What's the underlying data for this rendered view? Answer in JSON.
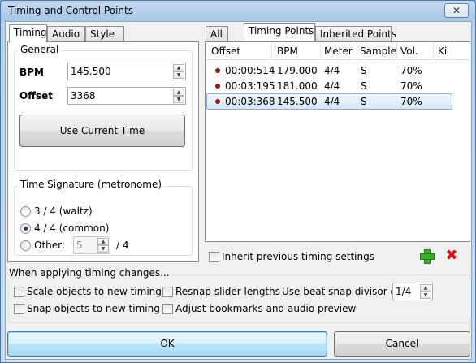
{
  "window": {
    "title": "Timing and Control Points",
    "close_glyph": "✕"
  },
  "left_tabs": [
    "Timing",
    "Audio",
    "Style"
  ],
  "general": {
    "group_label": "General",
    "bpm_label": "BPM",
    "bpm_value": "145.500",
    "offset_label": "Offset",
    "offset_value": "3368",
    "use_current_time": "Use Current Time"
  },
  "time_signature": {
    "group_label": "Time Signature (metronome)",
    "options": [
      "3 / 4 (waltz)",
      "4 / 4 (common)",
      "Other:"
    ],
    "selected_index": 1,
    "other_value": "5",
    "other_suffix": "/ 4"
  },
  "right_tabs": [
    "All",
    "Timing Points",
    "Inherited Points"
  ],
  "timing_table": {
    "columns": [
      "Offset",
      "BPM",
      "Meter",
      "Sample",
      "Vol.",
      "Ki"
    ],
    "rows": [
      {
        "offset": "00:00:514",
        "bpm": "179.000",
        "meter": "4/4",
        "sample": "S",
        "vol": "70%"
      },
      {
        "offset": "00:03:195",
        "bpm": "181.000",
        "meter": "4/4",
        "sample": "S",
        "vol": "70%"
      },
      {
        "offset": "00:03:368",
        "bpm": "145.500",
        "meter": "4/4",
        "sample": "S",
        "vol": "70%"
      }
    ],
    "selected_row": 2,
    "dot_color": "#8c1c12"
  },
  "inherit_label": "Inherit previous timing settings",
  "icons": {
    "add": "add-icon",
    "delete": "delete-icon"
  },
  "applying": {
    "group_label": "When applying timing changes...",
    "scale_objects": "Scale objects to new timing",
    "snap_objects": "Snap objects to new timing",
    "resnap_sliders": "Resnap slider lengths",
    "adjust_bookmarks": "Adjust bookmarks and audio preview",
    "beat_snap_label": "Use beat snap divisor of",
    "beat_snap_value": "1/4"
  },
  "buttons": {
    "ok": "OK",
    "cancel": "Cancel"
  },
  "colors": {
    "selection": "#d5e7f8",
    "add_green": "#3aae2a",
    "delete_red": "#dd1111"
  }
}
